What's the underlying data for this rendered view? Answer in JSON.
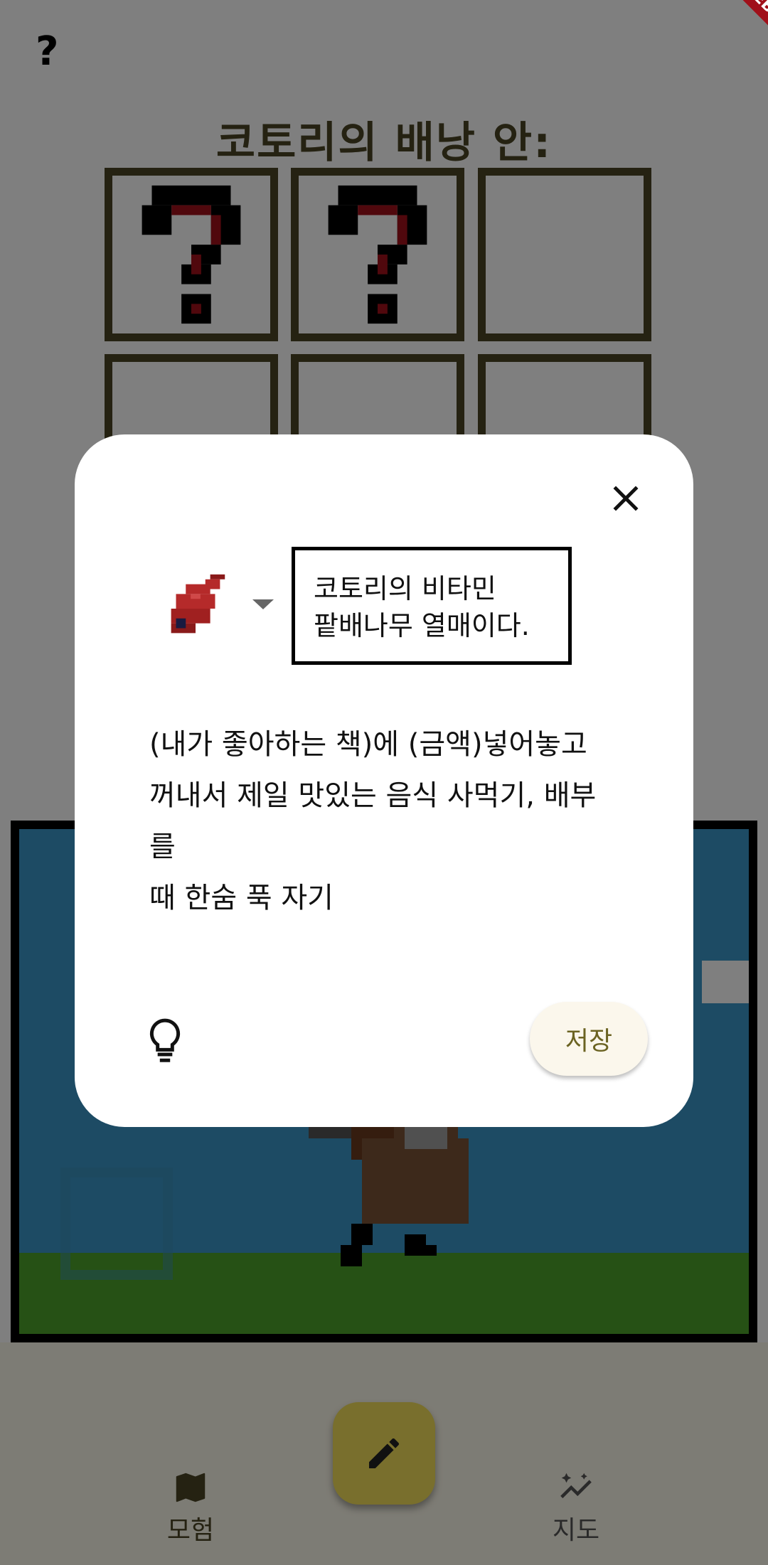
{
  "top": {
    "help_label": "?",
    "bag_title": "코토리의 배낭 안:"
  },
  "debug_banner": "DEBUG",
  "inventory": {
    "slots": [
      {
        "state": "unknown",
        "icon": "question-mark-icon"
      },
      {
        "state": "unknown",
        "icon": "question-mark-icon"
      },
      {
        "state": "empty"
      },
      {
        "state": "empty"
      },
      {
        "state": "empty"
      },
      {
        "state": "empty"
      }
    ]
  },
  "dialog": {
    "item_icon": "meat-icon",
    "item_description": "코토리의 비타민\n팥배나무 열매이다.",
    "body_text": "(내가 좋아하는 책)에 (금액)넣어놓고\n꺼내서 제일 맛있는 음식 사먹기, 배부를\n때 한숨 푹 자기",
    "save_label": "저장"
  },
  "nav": {
    "adventure_label": "모험",
    "map_label": "지도"
  },
  "colors": {
    "accent": "#4a4524",
    "fab": "#f2df5a",
    "sky": "#3b96c8",
    "grass": "#4da32a",
    "scrim": "rgba(0,0,0,0.5)"
  }
}
